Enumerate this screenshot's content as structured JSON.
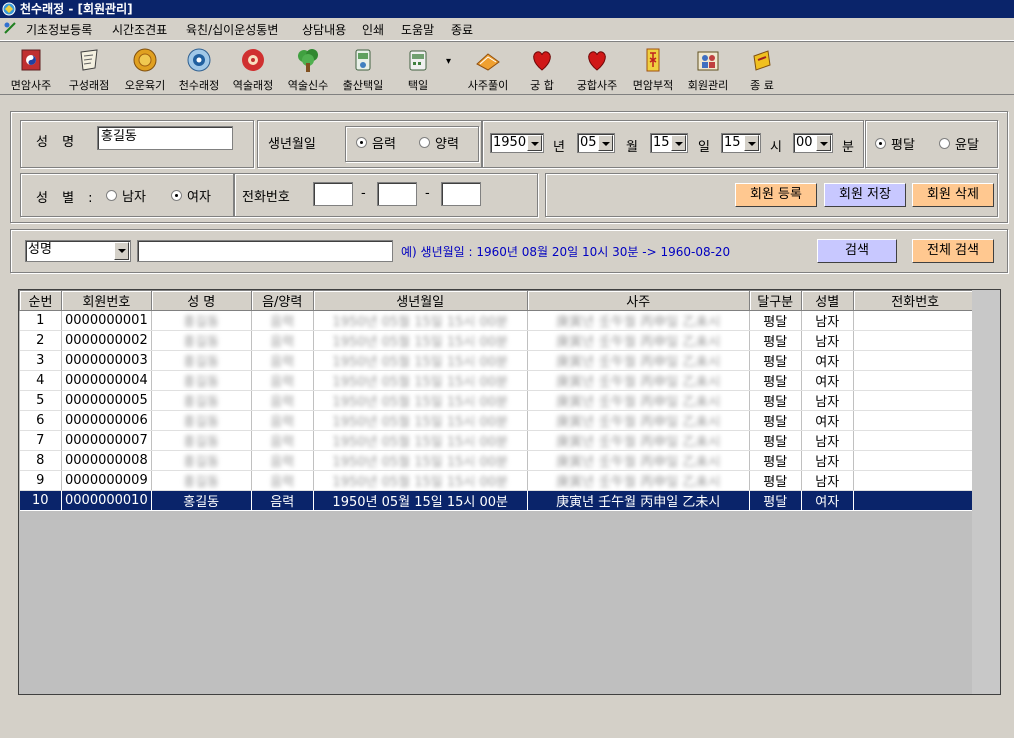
{
  "window": {
    "title": "천수래정 - [회원관리]"
  },
  "menu": [
    "기초정보등록",
    "시간조견표",
    "육친/십이운성통변",
    "상담내용",
    "인쇄",
    "도움말",
    "종료"
  ],
  "toolbar": [
    {
      "label": "면암사주",
      "icon": "book-icon"
    },
    {
      "label": "구성래점",
      "icon": "shield-icon"
    },
    {
      "label": "오운육기",
      "icon": "coin-icon"
    },
    {
      "label": "천수래정",
      "icon": "eye-icon"
    },
    {
      "label": "역술래정",
      "icon": "flower-icon"
    },
    {
      "label": "역술신수",
      "icon": "tree-icon"
    },
    {
      "label": "출산택일",
      "icon": "baby-icon"
    },
    {
      "label": "택일",
      "icon": "calendar-icon"
    },
    {
      "label": "사주풀이",
      "icon": "scroll-icon"
    },
    {
      "label": "궁 합",
      "icon": "heart-icon"
    },
    {
      "label": "궁합사주",
      "icon": "heart-icon"
    },
    {
      "label": "면암부적",
      "icon": "talisman-icon"
    },
    {
      "label": "회원관리",
      "icon": "members-icon"
    },
    {
      "label": "종 료",
      "icon": "exit-icon"
    }
  ],
  "form": {
    "name_label": "성  명",
    "name_value": "홍길동",
    "birth_label": "생년월일",
    "lunar_label": "음력",
    "solar_label": "양력",
    "year": "1950",
    "year_unit": "년",
    "month": "05",
    "month_unit": "월",
    "day": "15",
    "day_unit": "일",
    "hour": "15",
    "hour_unit": "시",
    "minute": "00",
    "minute_unit": "분",
    "normal_month_label": "평달",
    "leap_month_label": "윤달",
    "gender_label": "성  별 :",
    "male_label": "남자",
    "female_label": "여자",
    "phone_label": "전화번호",
    "phone_sep": "-",
    "register_btn": "회원 등록",
    "save_btn": "회원 저장",
    "delete_btn": "회원 삭제"
  },
  "search": {
    "field": "성명",
    "hint": "예) 생년월일 : 1960년 08월 20일  10시 30분 -> 1960-08-20",
    "search_btn": "검색",
    "all_btn": "전체 검색"
  },
  "table": {
    "headers": [
      "순번",
      "회원번호",
      "성  명",
      "음/양력",
      "생년월일",
      "사주",
      "달구분",
      "성별",
      "전화번호"
    ],
    "rows": [
      [
        "1",
        "0000000001",
        "",
        "",
        "",
        "",
        "평달",
        "남자",
        ""
      ],
      [
        "2",
        "0000000002",
        "",
        "",
        "",
        "",
        "평달",
        "남자",
        ""
      ],
      [
        "3",
        "0000000003",
        "",
        "",
        "",
        "",
        "평달",
        "여자",
        ""
      ],
      [
        "4",
        "0000000004",
        "",
        "",
        "",
        "",
        "평달",
        "여자",
        ""
      ],
      [
        "5",
        "0000000005",
        "",
        "",
        "",
        "",
        "평달",
        "남자",
        ""
      ],
      [
        "6",
        "0000000006",
        "",
        "",
        "",
        "",
        "평달",
        "여자",
        ""
      ],
      [
        "7",
        "0000000007",
        "",
        "",
        "",
        "",
        "평달",
        "남자",
        ""
      ],
      [
        "8",
        "0000000008",
        "",
        "",
        "",
        "",
        "평달",
        "남자",
        ""
      ],
      [
        "9",
        "0000000009",
        "",
        "",
        "",
        "",
        "평달",
        "남자",
        ""
      ],
      [
        "10",
        "0000000010",
        "홍길동",
        "음력",
        "1950년 05월 15일  15시 00분",
        "庚寅년 壬午월 丙申일 乙未시",
        "평달",
        "여자",
        ""
      ]
    ],
    "selected_row": 9,
    "selection_color": "#0a246a"
  }
}
